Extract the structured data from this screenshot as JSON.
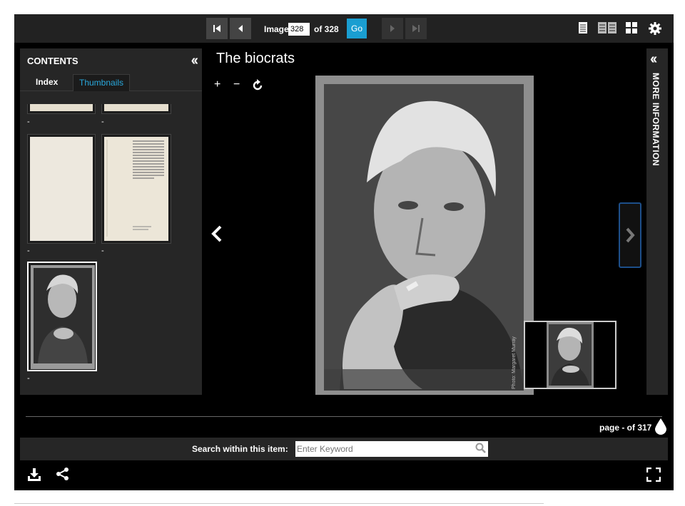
{
  "toolbar": {
    "first_label": "⏮",
    "prev_label": "◀",
    "image_label": "Image",
    "image_value": "328",
    "of_label": "of 328",
    "go_label": "Go",
    "next_label": "▶",
    "last_label": "⏭"
  },
  "contents_panel": {
    "title": "CONTENTS",
    "collapse_icon": "double-chevron-left-icon",
    "tabs": [
      {
        "label": "Index",
        "active": false
      },
      {
        "label": "Thumbnails",
        "active": true
      }
    ],
    "thumbnails": [
      {
        "label": "-"
      },
      {
        "label": "-"
      },
      {
        "label": "-"
      },
      {
        "label": "-"
      },
      {
        "label": "-",
        "selected": true
      }
    ]
  },
  "main": {
    "title": "The biocrats",
    "zoom_in": "+",
    "zoom_out": "−",
    "rotate_icon": "rotate-icon"
  },
  "info_panel": {
    "label": "MORE INFORMATION"
  },
  "footer": {
    "page_label": "page - of 317",
    "search_label": "Search within this item:",
    "search_placeholder": "Enter Keyword"
  },
  "colors": {
    "accent": "#1a9ed1",
    "tab_active": "#29a8dc",
    "panel": "#262626",
    "viewer_bg": "#000000"
  }
}
